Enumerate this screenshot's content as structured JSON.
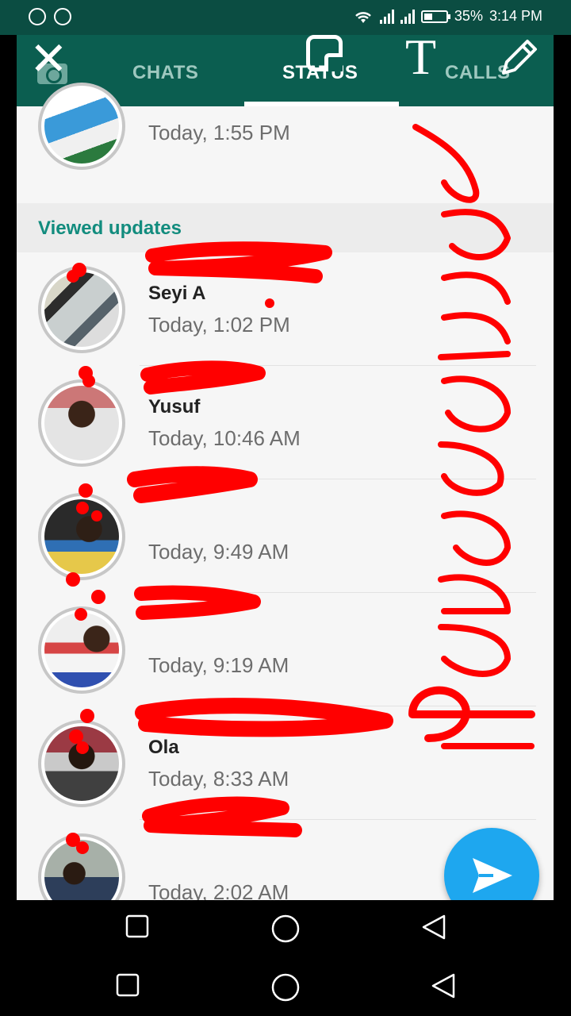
{
  "status_bar": {
    "battery": "35%",
    "time": "3:14 PM",
    "icons": [
      "vpn-icon",
      "music-icon",
      "wifi-icon",
      "signal-icon",
      "signal-icon",
      "battery-icon"
    ]
  },
  "tabs": [
    {
      "label": "CHATS",
      "active": false
    },
    {
      "label": "STATUS",
      "active": true
    },
    {
      "label": "CALLS",
      "active": false
    }
  ],
  "editor_tools": [
    "close-icon",
    "sticker-icon",
    "text-icon",
    "pencil-icon"
  ],
  "recent": {
    "time": "Today, 1:55 PM"
  },
  "viewed_header": "Viewed updates",
  "viewed": [
    {
      "name": "Seyi A",
      "time": "Today, 1:02 PM"
    },
    {
      "name": "Yusuf",
      "time": "Today, 10:46 AM"
    },
    {
      "name": "",
      "time": "Today, 9:49 AM"
    },
    {
      "name": "",
      "time": "Today, 9:19 AM"
    },
    {
      "name": "Ola",
      "time": "Today, 8:33 AM"
    },
    {
      "name": "",
      "time": "Today, 2:02 AM"
    }
  ],
  "drawing": {
    "handwritten_text": "Phonecorridor",
    "ink_color": "#ff0000"
  },
  "colors": {
    "toolbar": "#0b5e50",
    "accent": "#128c7e",
    "fab": "#1ea7ef"
  }
}
